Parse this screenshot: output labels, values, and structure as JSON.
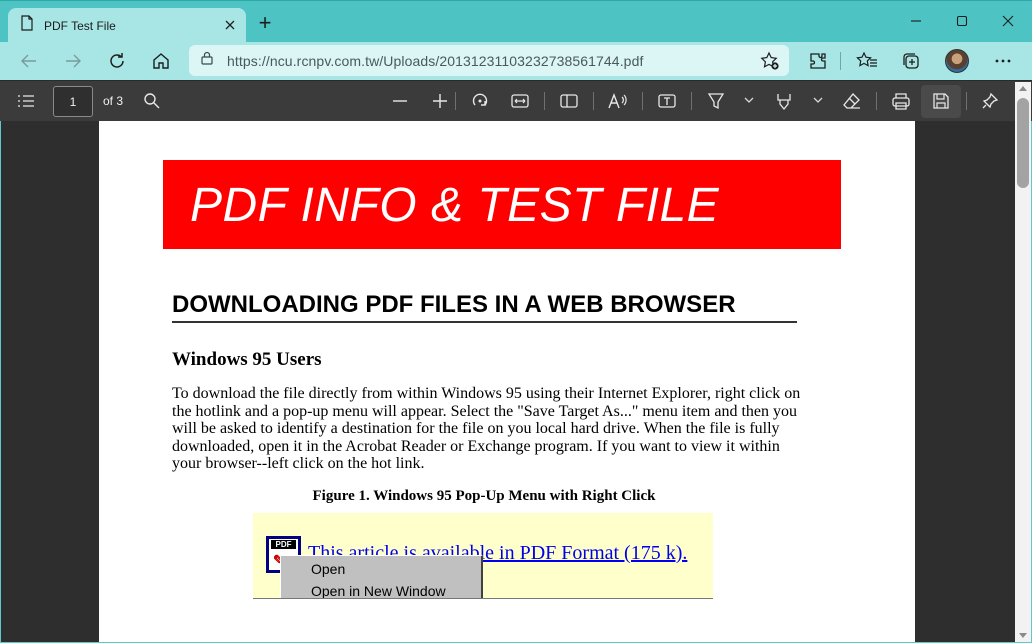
{
  "browser": {
    "tab_title": "PDF Test File",
    "new_tab_label": "+",
    "url": "https://ncu.rcnpv.com.tw/Uploads/20131231103232738561744.pdf"
  },
  "pdf_toolbar": {
    "page_number": "1",
    "page_count": "of 3"
  },
  "document": {
    "banner_title": "PDF INFO & TEST FILE",
    "heading": "DOWNLOADING PDF FILES IN A WEB BROWSER",
    "subheading": "Windows 95 Users",
    "paragraph": "To download the file directly from within Windows 95 using their Internet Explorer, right click on the hotlink and a pop-up menu will appear. Select the \"Save Target As...\" menu item and then you will be asked to identify a destination for the file on you local hard drive. When the file is fully downloaded, open it in the Acrobat Reader or Exchange program. If you want to view it within your browser--left click on the hot link.",
    "figure_caption": "Figure 1. Windows 95 Pop-Up Menu with Right Click",
    "figure": {
      "icon_label": "PDF",
      "link_text": "This article is available in PDF Format (175 k).",
      "menu_items": [
        "Open",
        "Open in New Window"
      ]
    }
  },
  "colors": {
    "titlebar": "#4dc3c3",
    "toolbar": "#a8e6e6",
    "pdf_toolbar": "#3b3b3b",
    "banner": "#ff0000",
    "figure_bg": "#ffffcc",
    "link": "#0000ee"
  },
  "icons": {
    "tab": "document-icon",
    "window": [
      "minimize-icon",
      "maximize-icon",
      "close-icon"
    ],
    "nav": [
      "back-icon",
      "forward-icon",
      "refresh-icon",
      "home-icon",
      "lock-icon",
      "add-favorite-icon",
      "extensions-icon",
      "favorites-icon",
      "collections-icon",
      "profile-avatar",
      "more-icon"
    ],
    "pdf": [
      "contents-icon",
      "search-icon",
      "zoom-out-icon",
      "zoom-in-icon",
      "rotate-icon",
      "fit-page-icon",
      "page-view-icon",
      "read-aloud-icon",
      "text-icon",
      "highlight-icon",
      "draw-icon",
      "erase-icon",
      "print-icon",
      "save-icon",
      "pin-icon"
    ]
  }
}
